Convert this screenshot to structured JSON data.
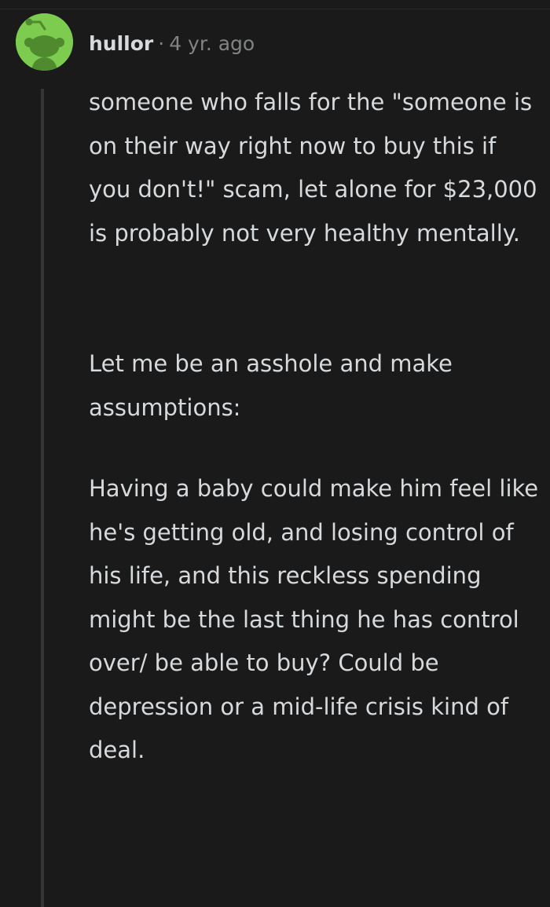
{
  "comment": {
    "author": "hullor",
    "separator": "·",
    "age": "4 yr. ago",
    "paragraphs": [
      "someone who falls for the \"someone is on their way right now to buy this if you don't!\" scam, let alone for $23,000 is probably not very healthy mentally.",
      "Let me be an asshole and make assumptions:",
      "Having a baby could make him feel like he's getting old, and losing control of his life, and this reckless spending might be the last thing he has control over/ be able to buy? Could be depression or a mid-life crisis kind of deal."
    ]
  },
  "avatar": {
    "icon": "snoo-avatar-icon",
    "background_color": "#7dcc4f"
  },
  "colors": {
    "background": "#1a1a1b",
    "text": "#d7dadc",
    "muted": "#818384",
    "thread_line": "#343536"
  }
}
